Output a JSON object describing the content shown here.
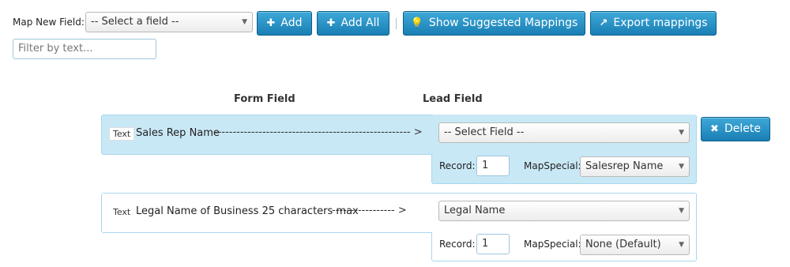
{
  "toolbar": {
    "map_label": "Map New Field:",
    "field_select": "-- Select a field --",
    "add_label": "Add",
    "add_all_label": "Add All",
    "suggest_label": "Show Suggested Mappings",
    "export_label": "Export mappings",
    "filter_placeholder": "Filter by text..."
  },
  "headers": {
    "form_field": "Form Field",
    "lead_field": "Lead Field"
  },
  "rows": [
    {
      "type": "Text",
      "field_name": "Sales Rep Name",
      "arrow": "-----------------------------------------------------  >",
      "lead_field": "-- Select Field --",
      "record_label": "Record:",
      "record_value": "1",
      "mapspecial_label": "MapSpecial:",
      "mapspecial_value": "Salesrep Name",
      "delete_label": "Delete"
    },
    {
      "type": "Text",
      "field_name": "Legal Name of Business 25 characters max",
      "arrow": "-----------------  >",
      "lead_field": "Legal Name",
      "record_label": "Record:",
      "record_value": "1",
      "mapspecial_label": "MapSpecial:",
      "mapspecial_value": "None (Default)"
    }
  ],
  "colors": {
    "button_blue": "#1a7fb4",
    "active_row": "#c9e8f6",
    "row_border": "#a8d6ee"
  }
}
